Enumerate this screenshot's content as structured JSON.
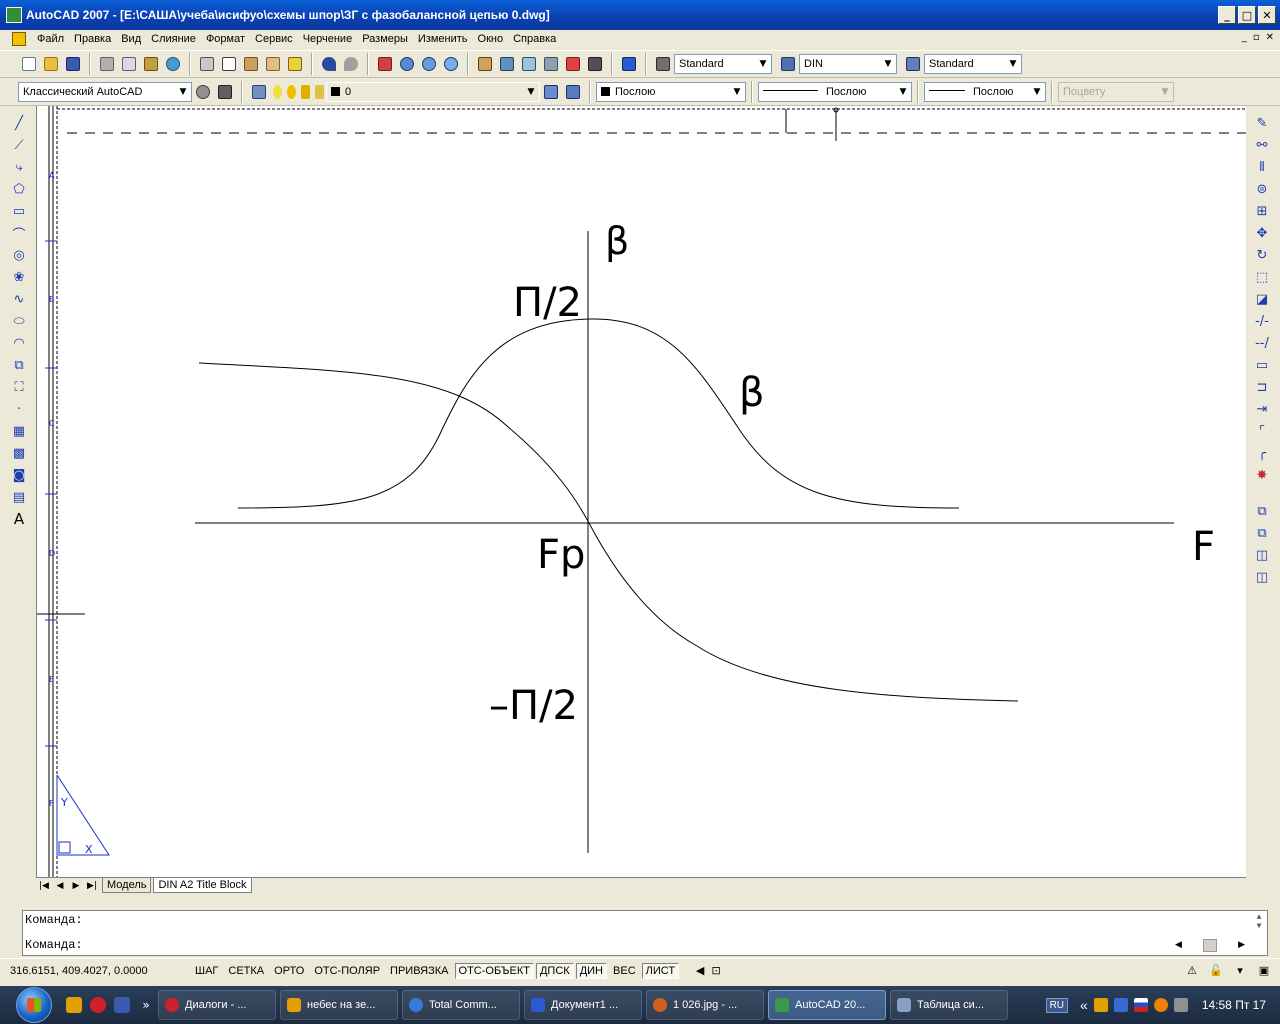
{
  "window": {
    "title": "AutoCAD 2007 - [E:\\САША\\учеба\\исифуо\\схемы шпор\\ЗГ с фазобалансной цепью 0.dwg]",
    "minimize": "_",
    "maximize": "□",
    "close": "✕"
  },
  "menu": {
    "items": [
      "Файл",
      "Правка",
      "Вид",
      "Слияние",
      "Формат",
      "Сервис",
      "Черчение",
      "Размеры",
      "Изменить",
      "Окно",
      "Справка"
    ],
    "doc_controls": [
      "_",
      "▫",
      "✕"
    ]
  },
  "toolbar1": {
    "text_style": "Standard",
    "dim_style": "DIN",
    "table_style": "Standard"
  },
  "toolbar2": {
    "workspace": "Классический AutoCAD",
    "layer": "0",
    "color": "Послою",
    "linetype": "Послою",
    "lineweight": "Послою",
    "plotstyle": "Поцвету"
  },
  "drawing": {
    "label_beta_axis": "β",
    "label_pi_half": "П/2",
    "label_beta_curve": "β",
    "label_fp": "Fp",
    "label_f": "F",
    "label_minus_pi_half": "–П/2",
    "ucs_y": "Y",
    "ucs_x": "X",
    "frame_marks": [
      "A",
      "B",
      "C",
      "D",
      "E",
      "F"
    ]
  },
  "tabs": {
    "nav": [
      "|◀",
      "◀",
      "▶",
      "▶|"
    ],
    "model": "Модель",
    "layout": "DIN A2 Title Block"
  },
  "command": {
    "line1": "Команда:",
    "line2": "Команда:"
  },
  "status": {
    "coords": "316.6151, 409.4027, 0.0000",
    "buttons": [
      {
        "label": "ШАГ",
        "on": false
      },
      {
        "label": "СЕТКА",
        "on": false
      },
      {
        "label": "ОРТО",
        "on": false
      },
      {
        "label": "ОТС-ПОЛЯР",
        "on": false
      },
      {
        "label": "ПРИВЯЗКА",
        "on": false
      },
      {
        "label": "ОТС-ОБЪЕКТ",
        "on": true
      },
      {
        "label": "ДПСК",
        "on": true
      },
      {
        "label": "ДИН",
        "on": true
      },
      {
        "label": "ВЕС",
        "on": false
      },
      {
        "label": "ЛИСТ",
        "on": true
      }
    ]
  },
  "taskbar": {
    "quick_chevron": "»",
    "tasks": [
      {
        "label": "Диалоги - ...",
        "color": "#d0202a",
        "active": false
      },
      {
        "label": "небес на зе...",
        "color": "#e0a000",
        "active": false
      },
      {
        "label": "Total Comm...",
        "color": "#3a7ad8",
        "active": false
      },
      {
        "label": "Документ1 ...",
        "color": "#2a5bd0",
        "active": false
      },
      {
        "label": "1 026.jpg - ...",
        "color": "#d06020",
        "active": false
      },
      {
        "label": "AutoCAD 20...",
        "color": "#3a9a4a",
        "active": true
      },
      {
        "label": "Таблица си...",
        "color": "#8aa0c0",
        "active": false
      }
    ],
    "lang": "RU",
    "tray_chevron": "«",
    "clock": "14:58 Пт 17"
  },
  "colors": {
    "titlebar": "#0a4fc8",
    "ucs_icon": "#1a2fd0",
    "accent_tools": "#1a3fb0"
  }
}
